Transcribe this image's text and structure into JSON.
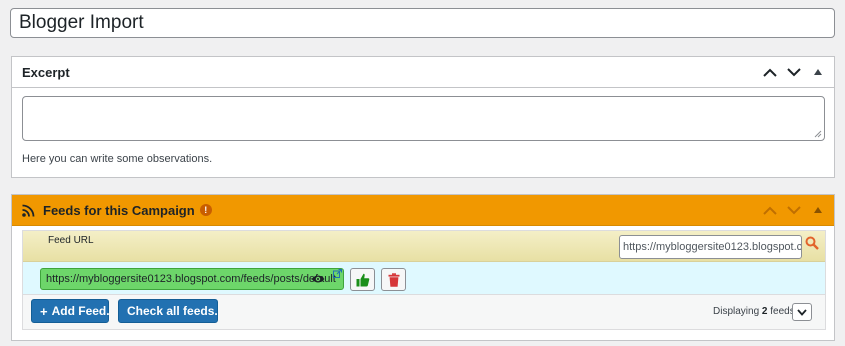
{
  "post_title": {
    "value": "Blogger Import"
  },
  "excerpt_box": {
    "title": "Excerpt",
    "help_text": "Here you can write some observations.",
    "textarea_value": ""
  },
  "feeds_box": {
    "title": "Feeds for this Campaign",
    "info_glyph": "!",
    "header_label": "Feed URL",
    "search_value": "https://mybloggersite0123.blogspot.c",
    "feeds": [
      {
        "url": "https://mybloggersite0123.blogspot.com/feeds/posts/default"
      }
    ],
    "add_button": "Add Feed.",
    "add_button_glyph": "+",
    "check_button": "Check all feeds.",
    "display_prefix": "Displaying",
    "display_count": "2",
    "display_suffix": "feeds"
  },
  "colors": {
    "feeds_header": "#f19800",
    "feed_ok": "#6dd66a",
    "primary_button": "#2271b1",
    "delete": "#d63638",
    "like": "#1a8f1a"
  },
  "icons": {
    "rss": "rss-icon",
    "info": "info-icon",
    "search": "search-icon",
    "eye": "eye-icon",
    "external": "external-link-icon",
    "thumbs_up": "thumbs-up-icon",
    "trash": "trash-icon",
    "chevron_up": "chevron-up-icon",
    "chevron_down": "chevron-down-icon",
    "toggle": "toggle-arrow-icon"
  }
}
